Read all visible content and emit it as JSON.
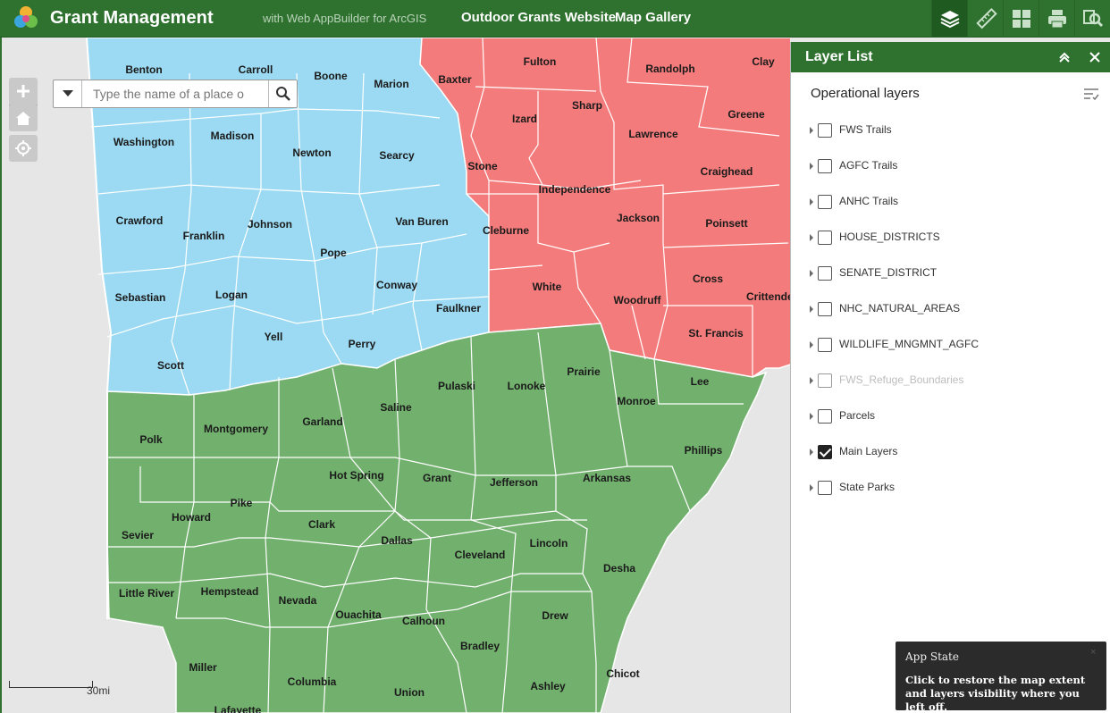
{
  "header": {
    "title": "Grant Management",
    "subtitle": "with Web AppBuilder for ArcGIS",
    "links": [
      "Outdoor Grants Website",
      "Map Gallery"
    ],
    "tools": [
      "layers-icon",
      "measure-icon",
      "widgets-icon",
      "print-icon",
      "query-icon"
    ]
  },
  "search": {
    "placeholder": "Type the name of a place o"
  },
  "scale": {
    "label": "30mi"
  },
  "colors": {
    "header": "#2f7230",
    "blue": "#9bdaf2",
    "red": "#f47b7b",
    "green": "#72b06e"
  },
  "map": {
    "counties": [
      "Benton",
      "Carroll",
      "Boone",
      "Marion",
      "Baxter",
      "Fulton",
      "Randolph",
      "Clay",
      "Washington",
      "Madison",
      "Newton",
      "Searcy",
      "Izard",
      "Sharp",
      "Greene",
      "Lawrence",
      "Stone",
      "Craighead",
      "Independence",
      "Crawford",
      "Franklin",
      "Johnson",
      "Van Buren",
      "Jackson",
      "Poinsett",
      "Cleburne",
      "Pope",
      "Sebastian",
      "Logan",
      "Conway",
      "White",
      "Faulkner",
      "Cross",
      "Crittenden",
      "Woodruff",
      "Yell",
      "Perry",
      "St. Francis",
      "Scott",
      "Prairie",
      "Pulaski",
      "Lonoke",
      "Lee",
      "Monroe",
      "Saline",
      "Garland",
      "Montgomery",
      "Polk",
      "Phillips",
      "Hot Spring",
      "Grant",
      "Jefferson",
      "Arkansas",
      "Pike",
      "Howard",
      "Clark",
      "Sevier",
      "Dallas",
      "Cleveland",
      "Lincoln",
      "Desha",
      "Little River",
      "Hempstead",
      "Nevada",
      "Ouachita",
      "Calhoun",
      "Drew",
      "Bradley",
      "Miller",
      "Chicot",
      "Columbia",
      "Ashley",
      "Union",
      "Lafayette"
    ]
  },
  "layer_list": {
    "title": "Layer List",
    "section": "Operational layers",
    "layers": [
      {
        "name": "FWS Trails",
        "checked": false
      },
      {
        "name": "AGFC Trails",
        "checked": false
      },
      {
        "name": "ANHC Trails",
        "checked": false
      },
      {
        "name": "HOUSE_DISTRICTS",
        "checked": false
      },
      {
        "name": "SENATE_DISTRICT",
        "checked": false
      },
      {
        "name": "NHC_NATURAL_AREAS",
        "checked": false
      },
      {
        "name": "WILDLIFE_MNGMNT_AGFC",
        "checked": false
      },
      {
        "name": "FWS_Refuge_Boundaries",
        "checked": false,
        "disabled": true
      },
      {
        "name": "Parcels",
        "checked": false
      },
      {
        "name": "Main Layers",
        "checked": true
      },
      {
        "name": "State Parks",
        "checked": false
      }
    ]
  },
  "toast": {
    "title": "App State",
    "body": "Click to restore the map extent and layers visibility where you left off.",
    "close": "×"
  }
}
